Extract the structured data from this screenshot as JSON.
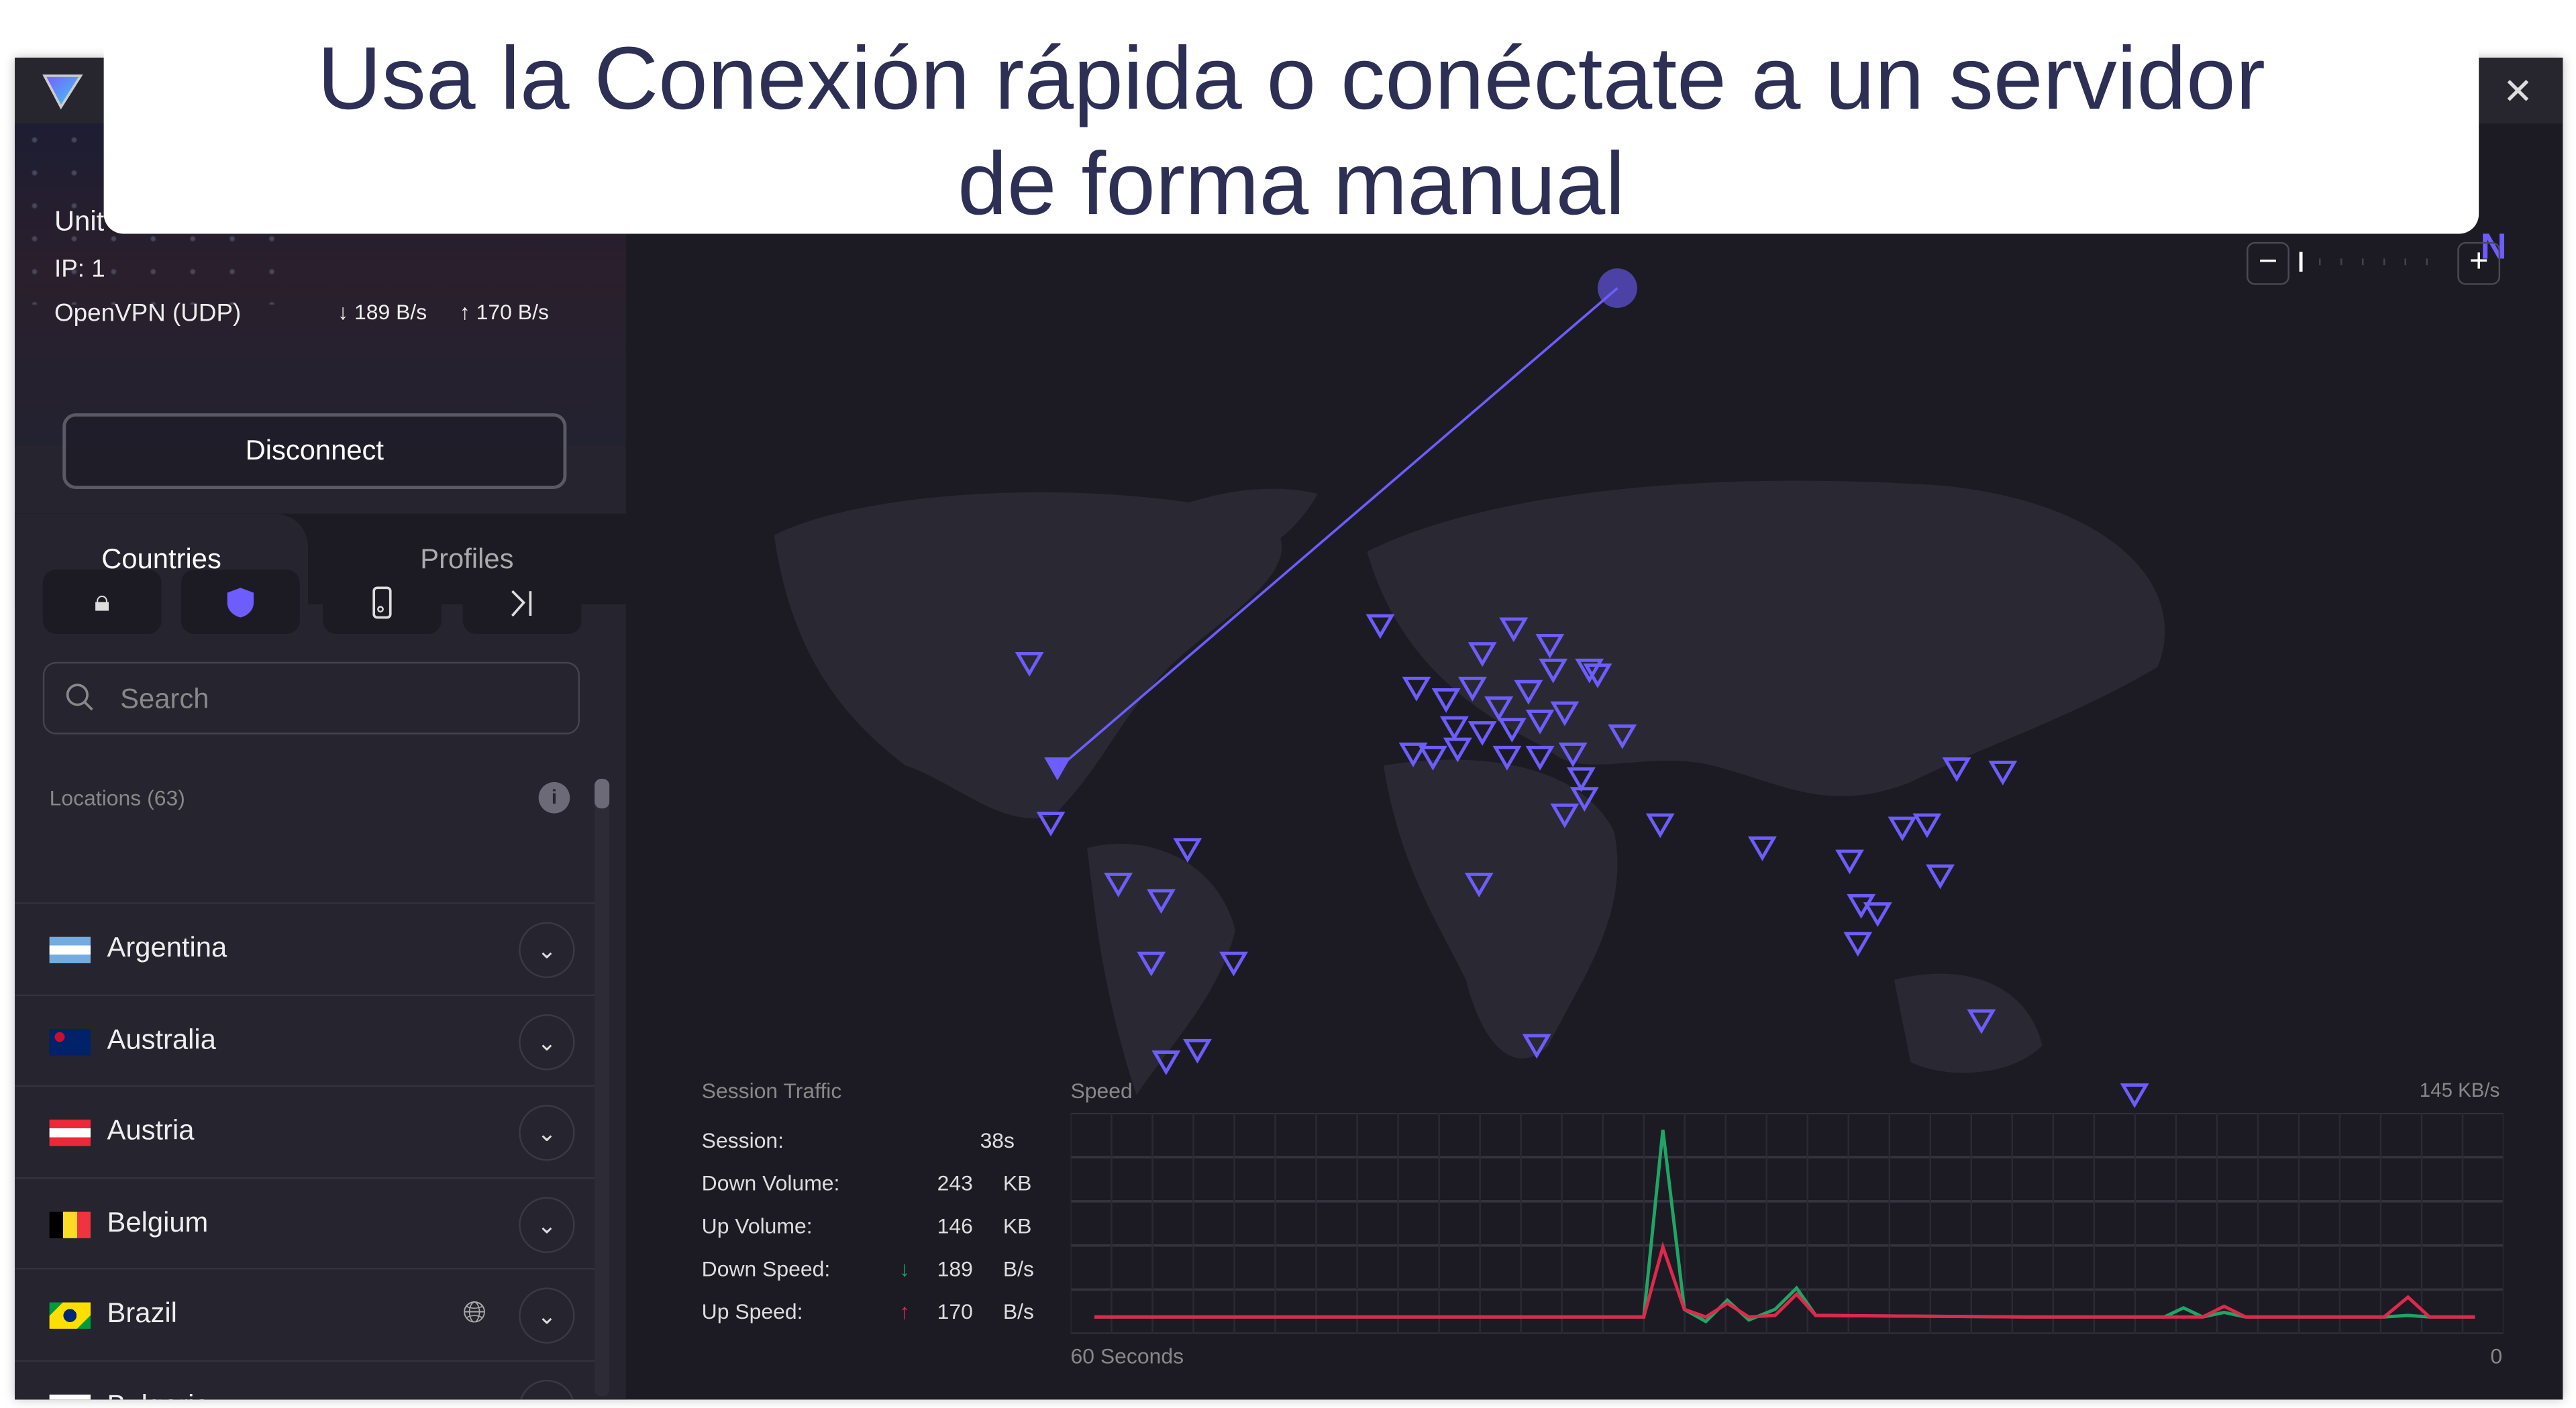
{
  "banner": {
    "line1": "Usa la Conexión rápida o conéctate a un servidor",
    "line2": "de forma manual"
  },
  "titlebar": {
    "close_icon": "close-icon"
  },
  "connection": {
    "country": "Unit",
    "ip": "IP: 1",
    "protocol": "OpenVPN (UDP)",
    "down": "189 B/s",
    "up": "170 B/s",
    "disconnect_label": "Disconnect",
    "partial_brand": "N"
  },
  "tabs": [
    {
      "label": "Countries",
      "active": true
    },
    {
      "label": "Profiles",
      "active": false
    }
  ],
  "filters": [
    "lock-icon",
    "shield-icon",
    "switch-icon",
    "split-tunnel-icon"
  ],
  "search": {
    "placeholder": "Search",
    "value": ""
  },
  "locations": {
    "label": "Locations (63)"
  },
  "countries": [
    {
      "name": "Argentina",
      "flag": "argentina"
    },
    {
      "name": "Australia",
      "flag": "australia"
    },
    {
      "name": "Austria",
      "flag": "austria"
    },
    {
      "name": "Belgium",
      "flag": "belgium"
    },
    {
      "name": "Brazil",
      "flag": "brazil",
      "globe": true
    },
    {
      "name": "Bulgaria",
      "flag": "bulgaria"
    }
  ],
  "session_traffic": {
    "title": "Session Traffic",
    "rows": [
      {
        "label": "Session:",
        "value": "38s",
        "unit": ""
      },
      {
        "label": "Down Volume:",
        "value": "243",
        "unit": "KB"
      },
      {
        "label": "Up Volume:",
        "value": "146",
        "unit": "KB"
      },
      {
        "label": "Down Speed:",
        "value": "189",
        "unit": "B/s",
        "arrow": "down"
      },
      {
        "label": "Up Speed:",
        "value": "170",
        "unit": "B/s",
        "arrow": "up"
      }
    ]
  },
  "colors": {
    "accent": "#6d5dfc",
    "down": "#1fa565",
    "up": "#e0284c"
  },
  "chart_data": {
    "type": "line",
    "title": "Speed",
    "ymax_label": "145  KB/s",
    "xlabel_left": "60 Seconds",
    "xlabel_right": "0",
    "xlim": [
      60,
      0
    ],
    "ylim": [
      0,
      145
    ],
    "grid": true,
    "x": [
      59,
      36,
      35.2,
      34.3,
      33.4,
      32.5,
      31.6,
      30.5,
      29.6,
      28.8,
      20,
      14.2,
      13.4,
      12.6,
      11.7,
      10.8,
      5,
      4,
      3.1,
      1.2
    ],
    "series": [
      {
        "key": "down",
        "values": [
          11,
          11,
          134,
          16,
          8,
          22,
          9,
          16,
          30,
          12,
          11,
          11,
          17,
          11,
          14,
          11,
          11,
          12,
          11,
          11
        ]
      },
      {
        "key": "up",
        "values": [
          11,
          11,
          57,
          16,
          11,
          20,
          11,
          12,
          26,
          12,
          11,
          11,
          11,
          11,
          18,
          11,
          11,
          24,
          11,
          11
        ]
      }
    ]
  }
}
